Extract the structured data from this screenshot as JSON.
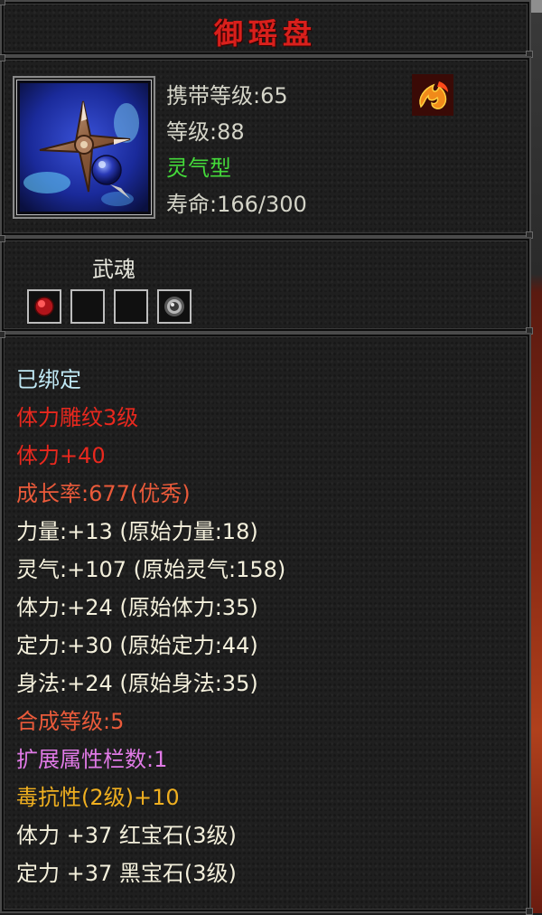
{
  "item": {
    "name": "御瑶盘",
    "carry_level": "携带等级:65",
    "level": "等级:88",
    "type": "灵气型",
    "lifespan": "寿命:166/300"
  },
  "soul": {
    "label": "武魂"
  },
  "stats": [
    {
      "text": "已绑定",
      "color": "#bfe8f4"
    },
    {
      "text": "体力雕纹3级",
      "color": "#e8281e"
    },
    {
      "text": "体力+40",
      "color": "#e8281e"
    },
    {
      "text": "成长率:677(优秀)",
      "color": "#ea5a3a"
    },
    {
      "text": "力量:+13 (原始力量:18)",
      "color": "#f4f0dc"
    },
    {
      "text": "灵气:+107 (原始灵气:158)",
      "color": "#f4f0dc"
    },
    {
      "text": "体力:+24 (原始体力:35)",
      "color": "#f4f0dc"
    },
    {
      "text": "定力:+30 (原始定力:44)",
      "color": "#f4f0dc"
    },
    {
      "text": "身法:+24 (原始身法:35)",
      "color": "#f4f0dc"
    },
    {
      "text": "合成等级:5",
      "color": "#ea5a3a"
    },
    {
      "text": "扩展属性栏数:1",
      "color": "#e07ae6"
    },
    {
      "text": "毒抗性(2级)+10",
      "color": "#f0b020"
    },
    {
      "text": "体力 +37 红宝石(3级)",
      "color": "#f4f0dc"
    },
    {
      "text": "定力 +37 黑宝石(3级)",
      "color": "#f4f0dc"
    }
  ],
  "colors": {
    "title": "#d8201c",
    "type_text": "#44d93a",
    "info_text": "#d4d4c8"
  },
  "icons": {
    "item_icon": "shuriken-disc-icon",
    "attribute_badge": "fire-element-icon",
    "slots": [
      "red-gem-icon",
      "empty-slot-icon",
      "empty-slot-icon",
      "silver-orb-icon"
    ]
  }
}
